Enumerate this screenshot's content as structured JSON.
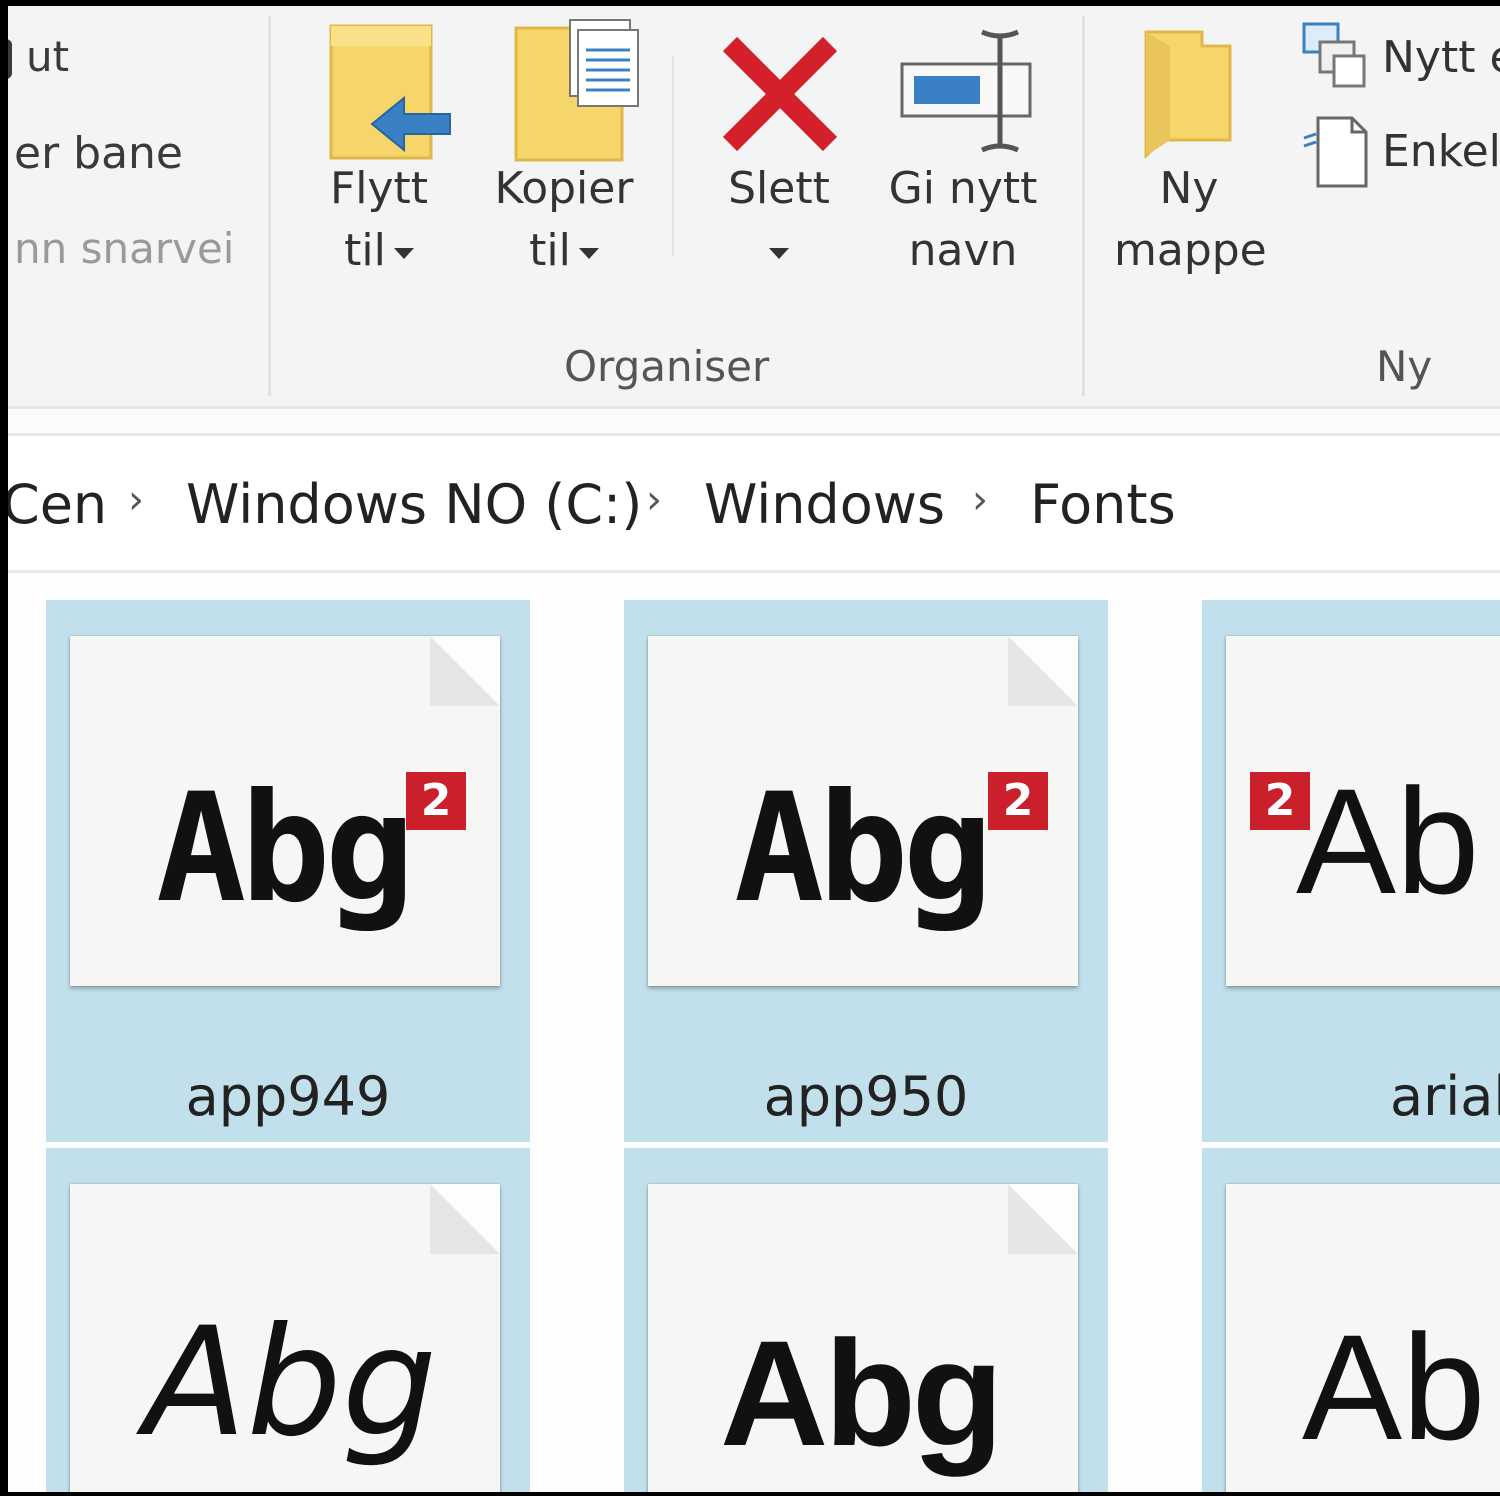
{
  "ribbon": {
    "clipboard_partial": {
      "item1": "ut",
      "item2": "er bane",
      "item3": "nn snarvei"
    },
    "organiser": {
      "group_label": "Organiser",
      "move_to": {
        "line1": "Flytt",
        "line2": "til"
      },
      "copy_to": {
        "line1": "Kopier",
        "line2": "til"
      },
      "delete": {
        "line1": "Slett"
      },
      "rename": {
        "line1": "Gi nytt",
        "line2": "navn"
      }
    },
    "new": {
      "group_label": "Ny",
      "new_folder": {
        "line1": "Ny",
        "line2": "mappe"
      },
      "new_item": "Nytt e",
      "easy_access": "Enkel"
    }
  },
  "address": {
    "crumbs": [
      "Cen",
      "Windows NO (C:)",
      "Windows",
      "Fonts"
    ],
    "separator": "›"
  },
  "files": [
    {
      "name": "app949",
      "sample": "Abg",
      "badge": "2"
    },
    {
      "name": "app950",
      "sample": "Abg",
      "badge": "2"
    },
    {
      "name": "arial",
      "sample": "Ab",
      "badge": "2"
    },
    {
      "name": "",
      "sample": "Abg"
    },
    {
      "name": "",
      "sample": "Abg"
    },
    {
      "name": "",
      "sample": "Ab"
    }
  ],
  "colors": {
    "tile_selected": "#c2e0ec",
    "delete_red": "#d4202a",
    "folder_yellow": "#f6d66a",
    "arrow_blue": "#3a80c4",
    "badge_red": "#c9202b"
  }
}
